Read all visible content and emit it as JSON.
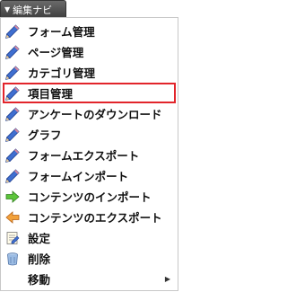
{
  "tab": {
    "label": "編集ナビ",
    "caret": "▼"
  },
  "menu": {
    "items": [
      {
        "label": "フォーム管理",
        "icon": "pencil-icon"
      },
      {
        "label": "ページ管理",
        "icon": "pencil-icon"
      },
      {
        "label": "カテゴリ管理",
        "icon": "pencil-icon"
      },
      {
        "label": "項目管理",
        "icon": "pencil-icon",
        "selected": true
      },
      {
        "label": "アンケートのダウンロード",
        "icon": "pencil-icon"
      },
      {
        "label": "グラフ",
        "icon": "pencil-icon"
      },
      {
        "label": "フォームエクスポート",
        "icon": "pencil-icon"
      },
      {
        "label": "フォームインポート",
        "icon": "pencil-icon"
      },
      {
        "label": "コンテンツのインポート",
        "icon": "green-right-arrow-icon"
      },
      {
        "label": "コンテンツのエクスポート",
        "icon": "orange-left-arrow-icon"
      },
      {
        "label": "設定",
        "icon": "settings-doc-icon"
      },
      {
        "label": "削除",
        "icon": "trash-icon"
      },
      {
        "label": "移動",
        "icon": "none",
        "submenu_arrow": "▶"
      }
    ]
  },
  "colors": {
    "selection_border": "#e2252b",
    "tab_background": "#4a4a4a"
  }
}
